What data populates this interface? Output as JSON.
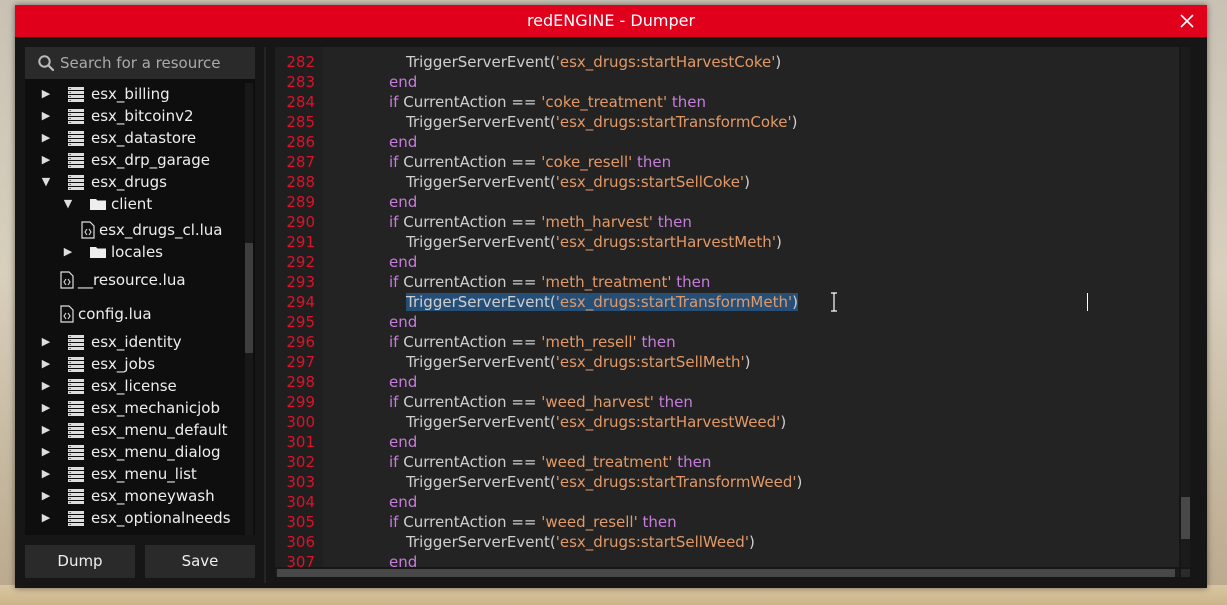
{
  "window": {
    "title": "redENGINE - Dumper"
  },
  "search": {
    "placeholder": "Search for a resource"
  },
  "tree": {
    "items": [
      {
        "label": "esx_billing",
        "type": "resource",
        "expanded": false
      },
      {
        "label": "esx_bitcoinv2",
        "type": "resource",
        "expanded": false
      },
      {
        "label": "esx_datastore",
        "type": "resource",
        "expanded": false
      },
      {
        "label": "esx_drp_garage",
        "type": "resource",
        "expanded": false
      },
      {
        "label": "esx_drugs",
        "type": "resource",
        "expanded": true
      },
      {
        "label": "client",
        "type": "folder",
        "expanded": true
      },
      {
        "label": "esx_drugs_cl.lua",
        "type": "file"
      },
      {
        "label": "locales",
        "type": "folder",
        "expanded": false
      },
      {
        "label": "__resource.lua",
        "type": "file"
      },
      {
        "label": "config.lua",
        "type": "file"
      },
      {
        "label": "esx_identity",
        "type": "resource",
        "expanded": false
      },
      {
        "label": "esx_jobs",
        "type": "resource",
        "expanded": false
      },
      {
        "label": "esx_license",
        "type": "resource",
        "expanded": false
      },
      {
        "label": "esx_mechanicjob",
        "type": "resource",
        "expanded": false
      },
      {
        "label": "esx_menu_default",
        "type": "resource",
        "expanded": false
      },
      {
        "label": "esx_menu_dialog",
        "type": "resource",
        "expanded": false
      },
      {
        "label": "esx_menu_list",
        "type": "resource",
        "expanded": false
      },
      {
        "label": "esx_moneywash",
        "type": "resource",
        "expanded": false
      },
      {
        "label": "esx_optionalneeds",
        "type": "resource",
        "expanded": false
      }
    ]
  },
  "buttons": {
    "dump": "Dump",
    "save": "Save"
  },
  "editor": {
    "lines": [
      {
        "n": "282",
        "kind": "call",
        "event": "esx_drugs:startHarvestCoke"
      },
      {
        "n": "283",
        "kind": "end"
      },
      {
        "n": "284",
        "kind": "if",
        "action": "coke_treatment"
      },
      {
        "n": "285",
        "kind": "call",
        "event": "esx_drugs:startTransformCoke"
      },
      {
        "n": "286",
        "kind": "end"
      },
      {
        "n": "287",
        "kind": "if",
        "action": "coke_resell"
      },
      {
        "n": "288",
        "kind": "call",
        "event": "esx_drugs:startSellCoke"
      },
      {
        "n": "289",
        "kind": "end"
      },
      {
        "n": "290",
        "kind": "if",
        "action": "meth_harvest"
      },
      {
        "n": "291",
        "kind": "call",
        "event": "esx_drugs:startHarvestMeth"
      },
      {
        "n": "292",
        "kind": "end"
      },
      {
        "n": "293",
        "kind": "if",
        "action": "meth_treatment"
      },
      {
        "n": "294",
        "kind": "call",
        "event": "esx_drugs:startTransformMeth",
        "selected": true
      },
      {
        "n": "295",
        "kind": "end"
      },
      {
        "n": "296",
        "kind": "if",
        "action": "meth_resell"
      },
      {
        "n": "297",
        "kind": "call",
        "event": "esx_drugs:startSellMeth"
      },
      {
        "n": "298",
        "kind": "end"
      },
      {
        "n": "299",
        "kind": "if",
        "action": "weed_harvest"
      },
      {
        "n": "300",
        "kind": "call",
        "event": "esx_drugs:startHarvestWeed"
      },
      {
        "n": "301",
        "kind": "end"
      },
      {
        "n": "302",
        "kind": "if",
        "action": "weed_treatment"
      },
      {
        "n": "303",
        "kind": "call",
        "event": "esx_drugs:startTransformWeed"
      },
      {
        "n": "304",
        "kind": "end"
      },
      {
        "n": "305",
        "kind": "if",
        "action": "weed_resell"
      },
      {
        "n": "306",
        "kind": "call",
        "event": "esx_drugs:startSellWeed"
      },
      {
        "n": "307",
        "kind": "end"
      }
    ],
    "tokens": {
      "kw_if": "if",
      "var": "CurrentAction",
      "op": "==",
      "kw_then": "then",
      "kw_end": "end",
      "func": "TriggerServerEvent"
    }
  },
  "colors": {
    "accent": "#e0001b",
    "line_number": "#e0102a",
    "keyword": "#c77ddb",
    "string": "#e39966",
    "selection": "#264f78"
  }
}
